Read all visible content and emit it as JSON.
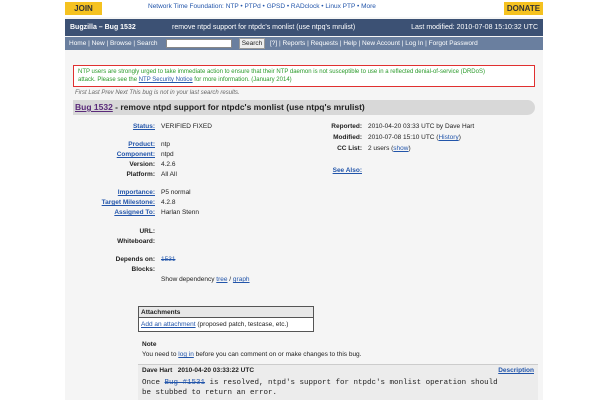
{
  "topbar": {
    "join": "JOIN",
    "donate": "DONATE",
    "foundation_label": "Network Time Foundation:",
    "foundation_links": "NTP • PTPd • GPSD • RADclock • Linux PTP • More"
  },
  "header": {
    "title": "Bugzilla – Bug 1532",
    "summary": "remove ntpd support for ntpdc's monlist (use ntpq's mrulist)",
    "last_modified": "Last modified: 2010-07-08 15:10:32 UTC"
  },
  "nav": {
    "left": "Home | New | Browse | Search",
    "search_button": "Search",
    "right": "[?] | Reports | Requests | Help | New Account | Log In | Forgot Password"
  },
  "alert": {
    "line1": "NTP users are strongly urged to take immediate action to ensure that their NTP daemon is not susceptible to use in a reflected denial-of-service (DRDoS)",
    "line2a": "attack.  Please see the ",
    "link": "NTP Security Notice",
    "line2b": " for more information.  (January 2014)"
  },
  "navline": "First Last Prev Next    This bug is not in your last search results.",
  "bug": {
    "id_link": "Bug 1532",
    "title": " - remove ntpd support for ntpdc's monlist (use ntpq's mrulist)"
  },
  "fields": {
    "status_label": "Status:",
    "status": "VERIFIED FIXED",
    "product_label": "Product:",
    "product": "ntp",
    "component_label": "Component:",
    "component": "ntpd",
    "version_label": "Version:",
    "version": "4.2.6",
    "platform_label": "Platform:",
    "platform": "All All",
    "importance_label": "Importance:",
    "importance": "P5 normal",
    "milestone_label": "Target Milestone:",
    "milestone": "4.2.8",
    "assigned_label": "Assigned To:",
    "assigned": "Harlan Stenn",
    "url_label": "URL:",
    "whiteboard_label": "Whiteboard:",
    "depends_label": "Depends on:",
    "depends": "1531",
    "blocks_label": "Blocks:",
    "show_dep": "Show dependency ",
    "tree": "tree",
    "sep": " / ",
    "graph": "graph"
  },
  "right_fields": {
    "reported_label": "Reported:",
    "reported": "2010-04-20 03:33 UTC by Dave Hart",
    "modified_label": "Modified:",
    "modified": "2010-07-08 15:10 UTC (",
    "history": "History",
    "modified_end": ")",
    "cc_label": "CC List:",
    "cc": "2 users (",
    "show": "show",
    "cc_end": ")",
    "see_also": "See Also:"
  },
  "attachments": {
    "header": "Attachments",
    "add": "Add an attachment",
    "add_note": " (proposed patch, testcase, etc.)"
  },
  "note": {
    "title": "Note",
    "text1": "You need to ",
    "login": "log in",
    "text2": " before you can comment on or make changes to this bug."
  },
  "comment": {
    "author": "Dave Hart",
    "date": "2010-04-20 03:33:22 UTC",
    "desc": "Description",
    "line1a": "Once ",
    "bug_ref": "Bug #1531",
    "line1b": " is resolved, ntpd's support for ntpdc's monlist operation should",
    "line2": "be stubbed to return an error."
  }
}
